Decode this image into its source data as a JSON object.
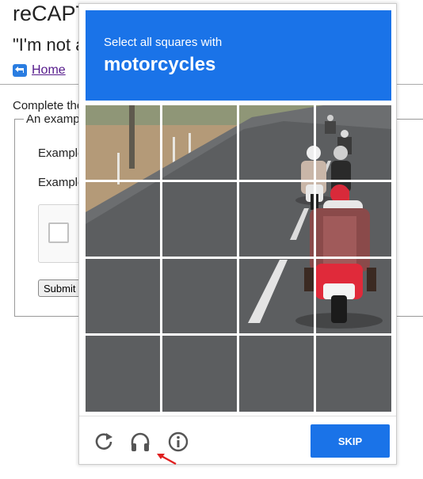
{
  "background_page": {
    "title": "reCAPTCHA demo",
    "subtitle": "\"I'm not a robot\"",
    "home_link": "Home",
    "complete_text": "Complete the form",
    "legend": "An example form",
    "example_label_1": "Example",
    "example_label_2": "Example",
    "submit_label": "Submit"
  },
  "challenge": {
    "instruction": "Select all squares with",
    "keyword": "motorcycles",
    "grid_rows": 4,
    "grid_cols": 4,
    "skip_label": "SKIP",
    "icons": [
      "reload-icon",
      "headphones-icon",
      "info-icon"
    ],
    "accent_color": "#1a73e8"
  },
  "annotation": {
    "arrow_color": "#e02020"
  }
}
